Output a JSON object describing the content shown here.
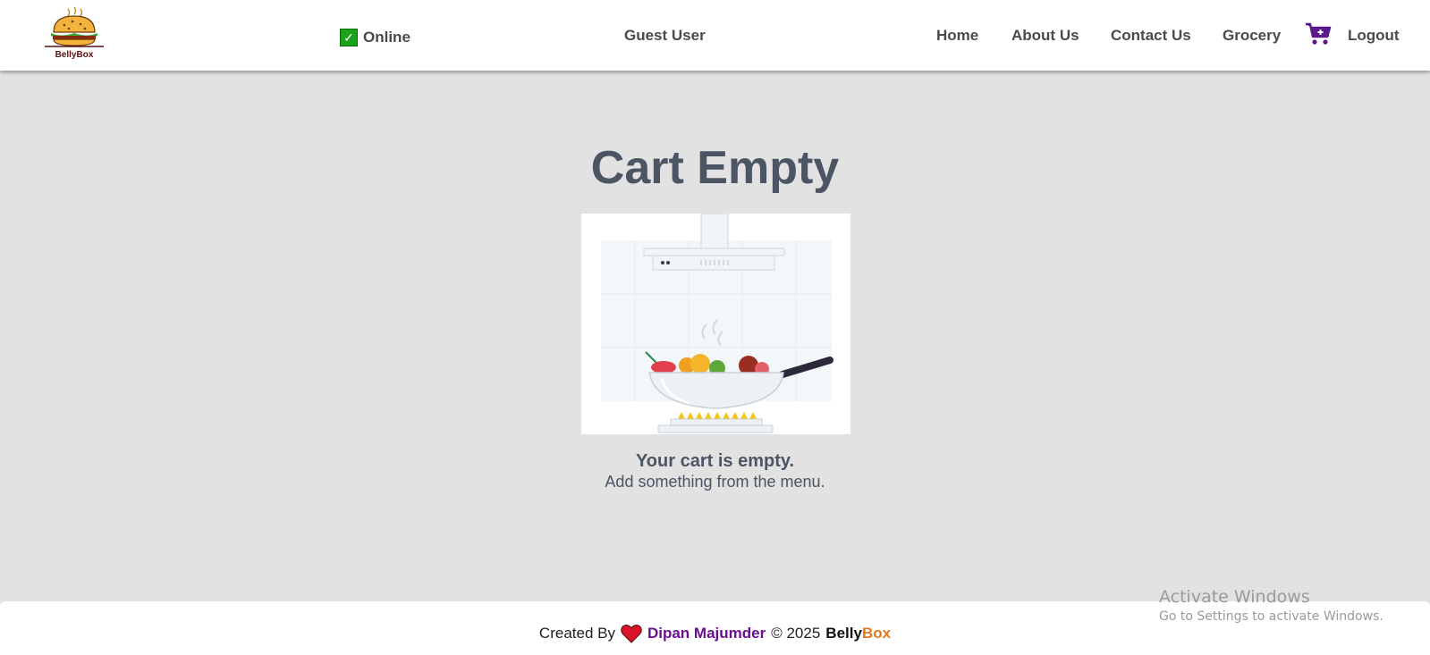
{
  "header": {
    "logo_text": "BellyBox",
    "status_label": "Online",
    "user_name": "Guest User",
    "nav": {
      "home": "Home",
      "about": "About Us",
      "contact": "Contact Us",
      "grocery": "Grocery",
      "logout": "Logout"
    },
    "icons": {
      "status": "check-icon",
      "cart": "cart-icon",
      "logo": "burger-logo-icon"
    }
  },
  "main": {
    "title": "Cart Empty",
    "message": "Your cart is empty.",
    "submessage": "Add something from the menu.",
    "illustration": "kitchen-pan-illustration"
  },
  "footer": {
    "created_by": "Created By",
    "author": "Dipan Majumder",
    "copyright": "© 2025",
    "brand_first": "Belly",
    "brand_second": "Box",
    "icon": "heart-icon"
  },
  "os_watermark": {
    "title": "Activate Windows",
    "subtitle": "Go to Settings to activate Windows."
  },
  "colors": {
    "background": "#e2e2e2",
    "header_bg": "#ffffff",
    "title_text": "#4b5563",
    "author": "#6a0f8e",
    "brand_accent": "#e07b1a",
    "cart_icon": "#5b1a8c",
    "online_check": "#1aa31a"
  }
}
